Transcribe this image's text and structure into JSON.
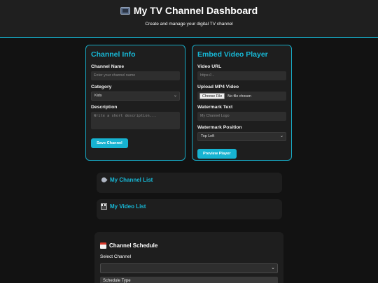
{
  "header": {
    "title": "My TV Channel Dashboard",
    "subtitle": "Create and manage your digital TV channel"
  },
  "channel_info": {
    "heading": "Channel Info",
    "name_label": "Channel Name",
    "name_placeholder": "Enter your channel name",
    "category_label": "Category",
    "category_value": "Kids",
    "description_label": "Description",
    "description_placeholder": "Write a short description...",
    "save_button": "Save Channel"
  },
  "embed_player": {
    "heading": "Embed Video Player",
    "url_label": "Video URL",
    "url_placeholder": "https://...",
    "upload_label": "Upload MP4 Video",
    "choose_file": "Choose File",
    "no_file": "No file chosen",
    "watermark_label": "Watermark Text",
    "watermark_placeholder": "My Channel Logo",
    "position_label": "Watermark Position",
    "position_value": "Top Left",
    "preview_button": "Preview Player"
  },
  "channel_list": {
    "heading": "My Channel List"
  },
  "video_list": {
    "heading": "My Video List"
  },
  "schedule": {
    "heading": "Channel Schedule",
    "select_label": "Select Channel",
    "select_value": "",
    "type_label": "Schedule Type"
  }
}
